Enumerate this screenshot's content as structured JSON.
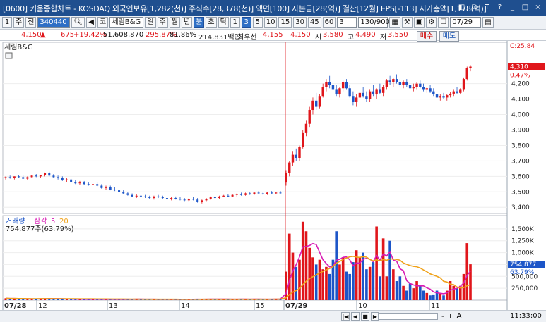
{
  "window": {
    "title": "[0600] 키움종합차트 - KOSDAQ 외국인보유[1,282(천)] 주식수[28,378(천)] 액면[100] 자본금[28(억)] 결산[12월] EPS[-113] 시가총액[1,178(억)]",
    "controls": [
      "◧",
      "⧉",
      "T",
      "?",
      "_",
      "□",
      "×"
    ]
  },
  "toolbar": {
    "tab_index": "1",
    "type_label": "주",
    "all_label": "전",
    "code": "340440",
    "name_prefix": "코",
    "name": "세림B&G",
    "periods": [
      "일",
      "주",
      "월",
      "년",
      "분",
      "초",
      "틱"
    ],
    "minutes": [
      "1",
      "3",
      "5",
      "10",
      "15",
      "30",
      "45",
      "60"
    ],
    "interval": "3",
    "count": "130/900",
    "date": "07/29"
  },
  "quote": {
    "price": "4,150",
    "change": "675",
    "change_pct": "+19.42%",
    "volume": "51,608,870",
    "volume_ratio": "295.87%",
    "rotation": "81.86%",
    "amount": "214,831백만",
    "best_label": "최우선",
    "ask": "4,155",
    "bid": "4,150",
    "open_label": "시",
    "open": "3,580",
    "high_label": "고",
    "high": "4,490",
    "low_label": "저",
    "low": "3,550",
    "buy_label": "매수",
    "sell_label": "매도"
  },
  "chart_data": {
    "type": "candlestick",
    "stock_label": "세림B&G",
    "price_axis": {
      "ticks": [
        "4,200",
        "4,100",
        "4,000",
        "3,900",
        "3,800",
        "3,700",
        "3,600",
        "3,500",
        "3,400"
      ],
      "range": [
        3360,
        4440
      ]
    },
    "current_price_label": "4,310",
    "current_pct_label": "0.47%",
    "top_label": "C:25.84",
    "volume_legend": {
      "name": "거래량",
      "ma_name": "삼각",
      "ma1": "5",
      "ma2": "20"
    },
    "volume_value": "754,877주(63.79%)",
    "volume_axis": {
      "ticks": [
        "1,500K",
        "1,250K",
        "1,000K",
        "750,000",
        "500,000",
        "250,000"
      ],
      "range": [
        0,
        1750000
      ]
    },
    "current_volume_label": "754,877",
    "current_volume_pct": "63.79%",
    "x_labels": [
      "07/28",
      "12",
      "13",
      "14",
      "15",
      "07/29",
      "10",
      "11"
    ],
    "candles_day1": [
      [
        3590,
        3600,
        3580,
        3595
      ],
      [
        3595,
        3605,
        3585,
        3590
      ],
      [
        3590,
        3600,
        3580,
        3600
      ],
      [
        3600,
        3610,
        3590,
        3595
      ],
      [
        3595,
        3605,
        3585,
        3585
      ],
      [
        3585,
        3600,
        3575,
        3595
      ],
      [
        3595,
        3610,
        3590,
        3605
      ],
      [
        3605,
        3615,
        3595,
        3600
      ],
      [
        3600,
        3610,
        3590,
        3610
      ],
      [
        3610,
        3625,
        3600,
        3620
      ],
      [
        3620,
        3630,
        3600,
        3605
      ],
      [
        3605,
        3615,
        3590,
        3595
      ],
      [
        3595,
        3605,
        3580,
        3590
      ],
      [
        3590,
        3600,
        3570,
        3575
      ],
      [
        3575,
        3590,
        3565,
        3580
      ],
      [
        3580,
        3590,
        3560,
        3565
      ],
      [
        3565,
        3575,
        3550,
        3555
      ],
      [
        3555,
        3570,
        3545,
        3560
      ],
      [
        3560,
        3570,
        3545,
        3550
      ],
      [
        3550,
        3560,
        3540,
        3545
      ],
      [
        3545,
        3560,
        3535,
        3550
      ],
      [
        3550,
        3560,
        3535,
        3540
      ],
      [
        3540,
        3550,
        3520,
        3525
      ],
      [
        3525,
        3540,
        3515,
        3530
      ],
      [
        3530,
        3540,
        3510,
        3515
      ],
      [
        3515,
        3530,
        3505,
        3510
      ],
      [
        3510,
        3520,
        3495,
        3500
      ],
      [
        3500,
        3510,
        3485,
        3490
      ],
      [
        3490,
        3500,
        3475,
        3480
      ],
      [
        3480,
        3490,
        3465,
        3470
      ],
      [
        3470,
        3485,
        3460,
        3475
      ],
      [
        3475,
        3485,
        3465,
        3470
      ],
      [
        3470,
        3480,
        3460,
        3465
      ],
      [
        3465,
        3475,
        3455,
        3460
      ],
      [
        3460,
        3475,
        3450,
        3470
      ],
      [
        3470,
        3480,
        3460,
        3465
      ],
      [
        3465,
        3475,
        3455,
        3460
      ],
      [
        3460,
        3470,
        3450,
        3455
      ],
      [
        3455,
        3465,
        3445,
        3460
      ],
      [
        3460,
        3470,
        3450,
        3455
      ],
      [
        3455,
        3465,
        3445,
        3450
      ],
      [
        3450,
        3460,
        3440,
        3445
      ],
      [
        3445,
        3460,
        3435,
        3455
      ],
      [
        3455,
        3465,
        3445,
        3450
      ],
      [
        3450,
        3460,
        3430,
        3435
      ],
      [
        3435,
        3450,
        3425,
        3445
      ],
      [
        3445,
        3460,
        3440,
        3455
      ],
      [
        3455,
        3470,
        3450,
        3465
      ],
      [
        3465,
        3475,
        3455,
        3460
      ],
      [
        3460,
        3475,
        3455,
        3470
      ],
      [
        3470,
        3480,
        3465,
        3475
      ],
      [
        3475,
        3485,
        3465,
        3470
      ],
      [
        3470,
        3485,
        3465,
        3480
      ],
      [
        3480,
        3490,
        3470,
        3485
      ],
      [
        3485,
        3495,
        3475,
        3480
      ],
      [
        3480,
        3495,
        3475,
        3490
      ],
      [
        3490,
        3500,
        3480,
        3485
      ],
      [
        3485,
        3500,
        3480,
        3495
      ],
      [
        3495,
        3505,
        3485,
        3490
      ],
      [
        3490,
        3500,
        3480,
        3485
      ],
      [
        3485,
        3500,
        3480,
        3495
      ],
      [
        3495,
        3505,
        3488,
        3490
      ],
      [
        3490,
        3500,
        3485,
        3495
      ],
      [
        3495,
        3505,
        3488,
        3492
      ]
    ],
    "candles_day2": [
      [
        3560,
        3640,
        3540,
        3620
      ],
      [
        3620,
        3700,
        3600,
        3690
      ],
      [
        3690,
        3760,
        3670,
        3740
      ],
      [
        3740,
        3780,
        3700,
        3720
      ],
      [
        3720,
        3800,
        3700,
        3790
      ],
      [
        3790,
        3900,
        3780,
        3880
      ],
      [
        3880,
        3960,
        3860,
        3940
      ],
      [
        3940,
        4050,
        3920,
        4030
      ],
      [
        4030,
        4110,
        4000,
        4090
      ],
      [
        4090,
        4140,
        4030,
        4050
      ],
      [
        4050,
        4130,
        4040,
        4120
      ],
      [
        4120,
        4200,
        4110,
        4180
      ],
      [
        4180,
        4230,
        4150,
        4210
      ],
      [
        4210,
        4250,
        4170,
        4190
      ],
      [
        4190,
        4210,
        4140,
        4160
      ],
      [
        4160,
        4190,
        4120,
        4130
      ],
      [
        4130,
        4180,
        4110,
        4170
      ],
      [
        4170,
        4220,
        4150,
        4210
      ],
      [
        4210,
        4230,
        4160,
        4170
      ],
      [
        4170,
        4190,
        4110,
        4120
      ],
      [
        4120,
        4150,
        4060,
        4080
      ],
      [
        4080,
        4130,
        4050,
        4110
      ],
      [
        4110,
        4160,
        4090,
        4140
      ],
      [
        4140,
        4180,
        4110,
        4120
      ],
      [
        4120,
        4150,
        4080,
        4100
      ],
      [
        4100,
        4160,
        4080,
        4150
      ],
      [
        4150,
        4190,
        4120,
        4130
      ],
      [
        4130,
        4170,
        4100,
        4160
      ],
      [
        4160,
        4200,
        4130,
        4140
      ],
      [
        4140,
        4190,
        4120,
        4180
      ],
      [
        4180,
        4230,
        4160,
        4220
      ],
      [
        4220,
        4250,
        4190,
        4210
      ],
      [
        4210,
        4240,
        4180,
        4230
      ],
      [
        4230,
        4260,
        4200,
        4210
      ],
      [
        4210,
        4230,
        4180,
        4190
      ],
      [
        4190,
        4220,
        4170,
        4210
      ],
      [
        4210,
        4230,
        4180,
        4190
      ],
      [
        4190,
        4210,
        4160,
        4170
      ],
      [
        4170,
        4200,
        4150,
        4180
      ],
      [
        4180,
        4210,
        4160,
        4200
      ],
      [
        4200,
        4220,
        4170,
        4180
      ],
      [
        4180,
        4200,
        4150,
        4160
      ],
      [
        4160,
        4180,
        4140,
        4170
      ],
      [
        4170,
        4190,
        4140,
        4150
      ],
      [
        4150,
        4170,
        4120,
        4130
      ],
      [
        4130,
        4150,
        4100,
        4110
      ],
      [
        4110,
        4130,
        4090,
        4120
      ],
      [
        4120,
        4140,
        4100,
        4110
      ],
      [
        4110,
        4130,
        4090,
        4125
      ],
      [
        4125,
        4145,
        4110,
        4135
      ],
      [
        4135,
        4160,
        4120,
        4150
      ],
      [
        4150,
        4180,
        4130,
        4140
      ],
      [
        4140,
        4170,
        4130,
        4160
      ],
      [
        4160,
        4240,
        4150,
        4230
      ],
      [
        4230,
        4310,
        4220,
        4300
      ],
      [
        4300,
        4320,
        4280,
        4310
      ]
    ],
    "volumes_day1": [
      40000,
      30000,
      35000,
      25000,
      30000,
      20000,
      25000,
      30000,
      35000,
      40000,
      30000,
      25000,
      20000,
      30000,
      25000,
      20000,
      18000,
      22000,
      20000,
      18000,
      25000,
      20000,
      15000,
      18000,
      20000,
      15000,
      18000,
      20000,
      22000,
      18000,
      25000,
      20000,
      15000,
      18000,
      20000,
      15000,
      18000,
      20000,
      15000,
      18000,
      20000,
      15000,
      18000,
      20000,
      22000,
      18000,
      20000,
      25000,
      22000,
      20000,
      18000,
      22000,
      20000,
      18000,
      25000,
      20000,
      18000,
      22000,
      20000,
      18000,
      22000,
      20000,
      25000,
      30000
    ],
    "volumes_day2": [
      600000,
      1400000,
      1000000,
      700000,
      850000,
      1650000,
      1450000,
      1100000,
      900000,
      750000,
      850000,
      650000,
      700000,
      550000,
      850000,
      1450000,
      750000,
      900000,
      600000,
      550000,
      800000,
      1050000,
      900000,
      1000000,
      650000,
      700000,
      800000,
      1550000,
      500000,
      1300000,
      500000,
      1250000,
      650000,
      400000,
      500000,
      300000,
      200000,
      350000,
      250000,
      400000,
      300000,
      200000,
      150000,
      100000,
      120000,
      200000,
      150000,
      100000,
      200000,
      400000,
      300000,
      250000,
      300000,
      550000,
      1200000,
      754877
    ]
  },
  "bottom": {
    "nav": [
      "|◀",
      "◀",
      "■",
      "▶",
      "▶|"
    ],
    "zoom": [
      "-",
      "+",
      "A"
    ],
    "time": "11:33:00"
  }
}
